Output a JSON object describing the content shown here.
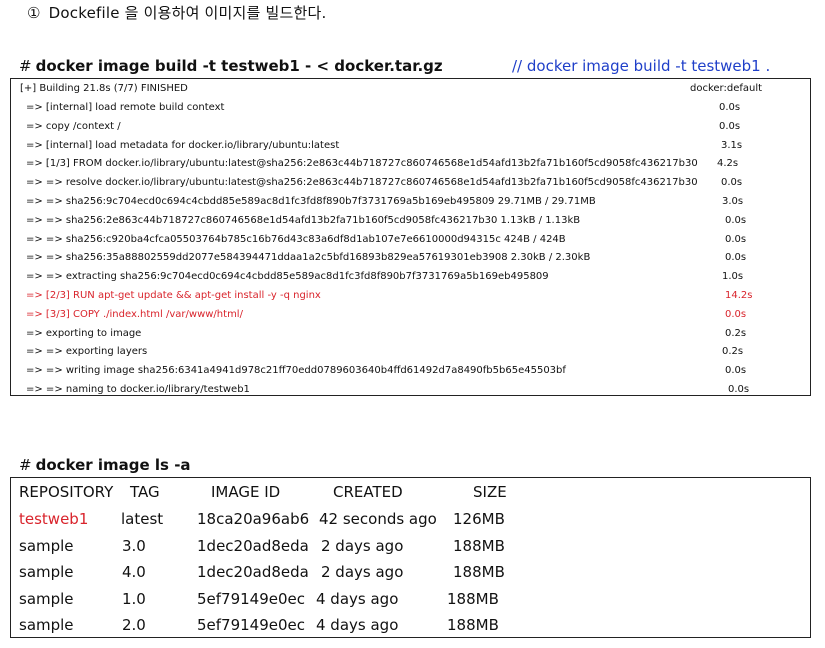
{
  "step": {
    "marker": "①",
    "text": "Dockefile 을 이용하여 이미지를 빌드한다."
  },
  "build": {
    "prompt": "#",
    "command": "docker image build -t testweb1 - < docker.tar.gz",
    "comment": "// docker image build -t testweb1 .",
    "header": {
      "text": "[+] Building 21.8s (7/7) FINISHED",
      "right": "docker:default"
    },
    "lines": [
      {
        "text": "=> [internal] load remote build context",
        "time": "0.0s",
        "red": false
      },
      {
        "text": "=> copy /context /",
        "time": "0.0s",
        "red": false
      },
      {
        "text": "=> [internal] load metadata for docker.io/library/ubuntu:latest",
        "time": "3.1s",
        "red": false
      },
      {
        "text": "=> [1/3] FROM docker.io/library/ubuntu:latest@sha256:2e863c44b718727c860746568e1d54afd13b2fa71b160f5cd9058fc436217b30",
        "time": "4.2s",
        "red": false
      },
      {
        "text": "=> => resolve docker.io/library/ubuntu:latest@sha256:2e863c44b718727c860746568e1d54afd13b2fa71b160f5cd9058fc436217b30",
        "time": "0.0s",
        "red": false
      },
      {
        "text": "=> => sha256:9c704ecd0c694c4cbdd85e589ac8d1fc3fd8f890b7f3731769a5b169eb495809 29.71MB / 29.71MB",
        "time": "3.0s",
        "red": false
      },
      {
        "text": "=> => sha256:2e863c44b718727c860746568e1d54afd13b2fa71b160f5cd9058fc436217b30 1.13kB / 1.13kB",
        "time": "0.0s",
        "red": false
      },
      {
        "text": "=> => sha256:c920ba4cfca05503764b785c16b76d43c83a6df8d1ab107e7e6610000d94315c 424B / 424B",
        "time": "0.0s",
        "red": false
      },
      {
        "text": "=> => sha256:35a88802559dd2077e584394471ddaa1a2c5bfd16893b829ea57619301eb3908 2.30kB / 2.30kB",
        "time": "0.0s",
        "red": false
      },
      {
        "text": "=> => extracting sha256:9c704ecd0c694c4cbdd85e589ac8d1fc3fd8f890b7f3731769a5b169eb495809",
        "time": "1.0s",
        "red": false
      },
      {
        "text": "=> [2/3] RUN apt-get update && apt-get install -y -q nginx",
        "time": "14.2s",
        "red": true
      },
      {
        "text": "=> [3/3] COPY ./index.html /var/www/html/",
        "time": "0.0s",
        "red": true
      },
      {
        "text": "=> exporting to image",
        "time": "0.2s",
        "red": false
      },
      {
        "text": "=> => exporting layers",
        "time": "0.2s",
        "red": false
      },
      {
        "text": "=> => writing image sha256:6341a4941d978c21ff70edd0789603640b4ffd61492d7a8490fb5b65e45503bf",
        "time": "0.0s",
        "red": false
      },
      {
        "text": "=> => naming to docker.io/library/testweb1",
        "time": "0.0s",
        "red": false
      }
    ]
  },
  "ls": {
    "prompt": "#",
    "command": "docker image ls -a",
    "headers": [
      "REPOSITORY",
      "TAG",
      "IMAGE ID",
      "CREATED",
      "SIZE"
    ],
    "rows": [
      {
        "cells": [
          "testweb1",
          "latest",
          "18ca20a96ab6",
          "42 seconds ago",
          "126MB"
        ],
        "red": true
      },
      {
        "cells": [
          "sample",
          "3.0",
          "1dec20ad8eda",
          "2 days ago",
          "188MB"
        ],
        "red": false
      },
      {
        "cells": [
          "sample",
          "4.0",
          "1dec20ad8eda",
          "2 days ago",
          "188MB"
        ],
        "red": false
      },
      {
        "cells": [
          "sample",
          "1.0",
          "5ef79149e0ec",
          "4 days ago",
          "188MB"
        ],
        "red": false
      },
      {
        "cells": [
          "sample",
          "2.0",
          "5ef79149e0ec",
          "4 days ago",
          "188MB"
        ],
        "red": false
      }
    ]
  },
  "colors": {
    "highlight": "#d9242c",
    "comment": "#1f3fc9"
  }
}
